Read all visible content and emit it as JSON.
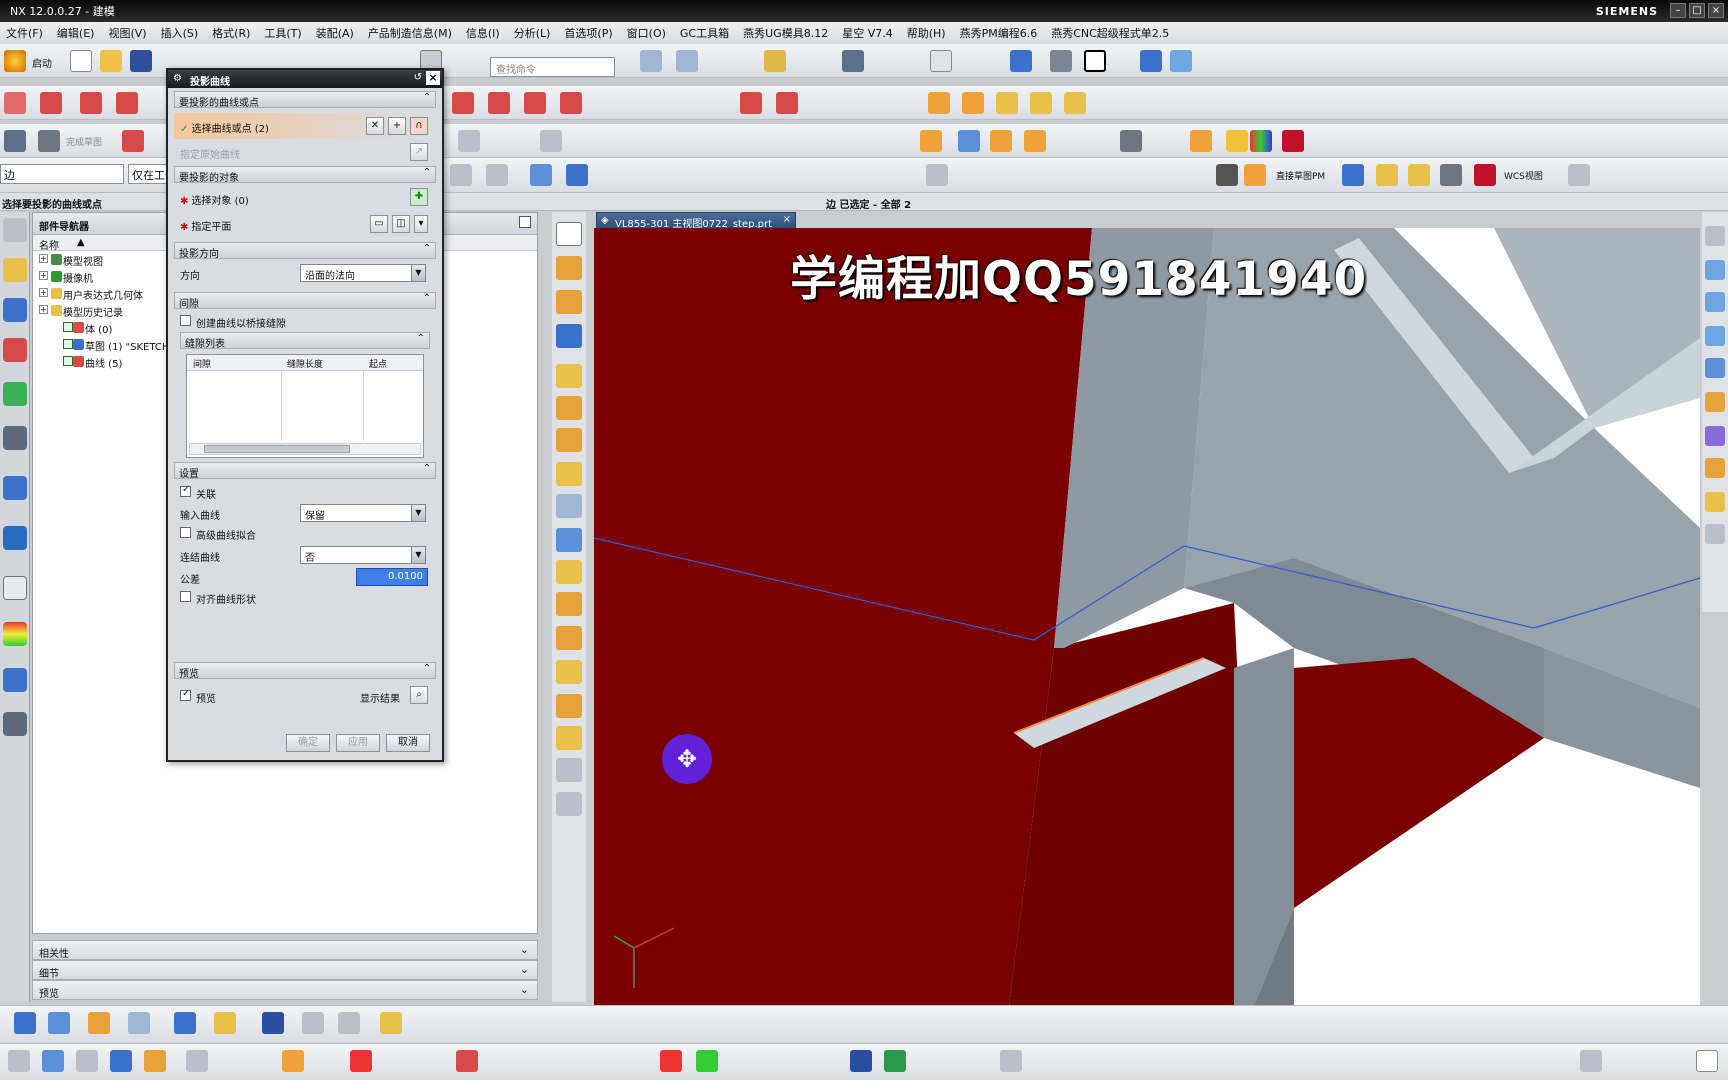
{
  "window": {
    "title": "NX 12.0.0.27 - 建模",
    "brand": "SIEMENS"
  },
  "menu": [
    "文件(F)",
    "编辑(E)",
    "视图(V)",
    "插入(S)",
    "格式(R)",
    "工具(T)",
    "装配(A)",
    "产品制造信息(M)",
    "信息(I)",
    "分析(L)",
    "首选项(P)",
    "窗口(O)",
    "GC工具箱",
    "燕秀UG模具8.12",
    "星空 V7.4",
    "帮助(H)",
    "燕秀PM编程6.6",
    "燕秀CNC超级程式单2.5"
  ],
  "toolbar": {
    "start_label": "启动",
    "command_finder_placeholder": "查找命令",
    "finish_sketch": "完成草图",
    "filter_value": "边",
    "filter_scope": "仅在工作部件内",
    "wcs_label": "WCS视图",
    "direct_sketch": "直接草图PM"
  },
  "status": {
    "prompt": "选择要投影的曲线或点",
    "selection": "边 已选定 - 全部 2"
  },
  "navigator": {
    "title": "部件导航器",
    "column_name": "名称",
    "nodes": [
      {
        "label": "模型视图"
      },
      {
        "label": "摄像机"
      },
      {
        "label": "用户表达式几何体"
      },
      {
        "label": "模型历史记录"
      },
      {
        "label": "体 (0)"
      },
      {
        "label": "草图 (1) \"SKETCH_000\""
      },
      {
        "label": "曲线 (5)"
      }
    ],
    "panels": [
      "相关性",
      "细节",
      "预览"
    ]
  },
  "dialog": {
    "title": "投影曲线",
    "sec_curves": "要投影的曲线或点",
    "curves_selected": "选择曲线或点 (2)",
    "specify_origin": "指定原始曲线",
    "sec_objects": "要投影的对象",
    "select_object": "选择对象 (0)",
    "specify_plane": "指定平面",
    "sec_direction": "投影方向",
    "direction_label": "方向",
    "direction_value": "沿面的法向",
    "sec_gap": "间隙",
    "bridge_gap": "创建曲线以桥接缝隙",
    "gap_list": "缝隙列表",
    "gap_cols": [
      "间隙",
      "缝隙长度",
      "起点"
    ],
    "sec_settings": "设置",
    "associative": "关联",
    "input_curves_label": "输入曲线",
    "input_curves_value": "保留",
    "advanced_fit": "高级曲线拟合",
    "join_curves_label": "连结曲线",
    "join_curves_value": "否",
    "tolerance_label": "公差",
    "tolerance_value": "0.0100",
    "align_shape": "对齐曲线形状",
    "sec_preview": "预览",
    "preview": "预览",
    "show_result": "显示结果",
    "ok": "确定",
    "apply": "应用",
    "cancel": "取消"
  },
  "viewport": {
    "tab": "VL855-301 主视图0722_step.prt",
    "watermark": "学编程加QQ591841940"
  },
  "colors": {
    "red_face": "#7a0000",
    "grey_face": "#8e99a3",
    "light_face": "#c9d3da",
    "accent_blue": "#2d5fd0",
    "cursor": "#6021d8"
  }
}
